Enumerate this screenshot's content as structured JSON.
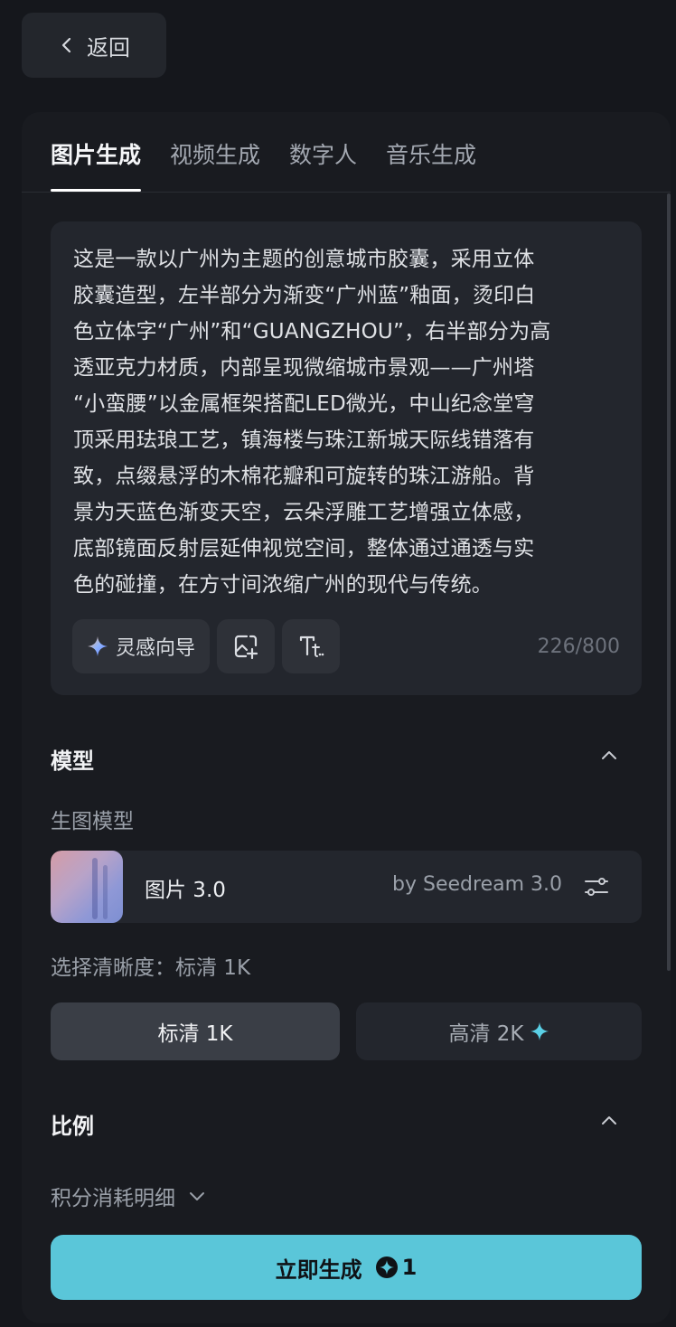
{
  "back": {
    "label": "返回"
  },
  "tabs": [
    {
      "label": "图片生成",
      "active": true
    },
    {
      "label": "视频生成",
      "active": false
    },
    {
      "label": "数字人",
      "active": false
    },
    {
      "label": "音乐生成",
      "active": false
    }
  ],
  "prompt": {
    "lines": [
      "这是一款以广州为主题的创意城市胶囊，采用立体",
      "胶囊造型，左半部分为渐变“广州蓝”釉面，烫印白",
      "色立体字“广州”和“GUANGZHOU”，右半部分为高",
      "透亚克力材质，内部呈现微缩城市景观——广州塔",
      "“小蛮腰”以金属框架搭配LED微光，中山纪念堂穹",
      "顶采用珐琅工艺，镇海楼与珠江新城天际线错落有",
      "致，点缀悬浮的木棉花瓣和可旋转的珠江游船。背",
      "景为天蓝色渐变天空，云朵浮雕工艺增强立体感，",
      "底部镜面反射层延伸视觉空间，整体通过通透与实",
      "色的碰撞，在方寸间浓缩广州的现代与传统。"
    ],
    "inspiration_label": "灵感向导",
    "counter": "226/800"
  },
  "model_section": {
    "title": "模型",
    "sub_label": "生图模型",
    "model_name": "图片 3.0",
    "model_by": "by Seedream 3.0",
    "resolution_label": "选择清晰度：标清 1K",
    "options": [
      {
        "label": "标清 1K",
        "selected": true
      },
      {
        "label": "高清 2K",
        "selected": false
      }
    ]
  },
  "ratio_section": {
    "title": "比例"
  },
  "credits_label": "积分消耗明细",
  "generate": {
    "label": "立即生成",
    "cost": "1"
  },
  "colors": {
    "accent": "#5ac6d9",
    "panel": "#191b20",
    "background": "#15171c"
  }
}
